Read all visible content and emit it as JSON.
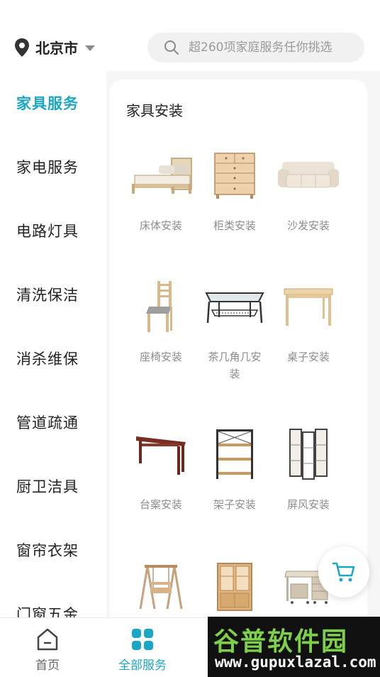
{
  "header": {
    "city": "北京市",
    "search_placeholder": "超260项家庭服务任你挑选"
  },
  "sidebar": {
    "items": [
      {
        "label": "家具服务",
        "active": true
      },
      {
        "label": "家电服务"
      },
      {
        "label": "电路灯具"
      },
      {
        "label": "清洗保洁"
      },
      {
        "label": "消杀维保"
      },
      {
        "label": "管道疏通"
      },
      {
        "label": "厨卫洁具"
      },
      {
        "label": "窗帘衣架"
      },
      {
        "label": "门窗五金"
      }
    ]
  },
  "section": {
    "title": "家具安装",
    "items": [
      {
        "label": "床体安装",
        "icon": "bed-icon"
      },
      {
        "label": "柜类安装",
        "icon": "cabinet-icon"
      },
      {
        "label": "沙发安装",
        "icon": "sofa-icon"
      },
      {
        "label": "座椅安装",
        "icon": "chair-icon"
      },
      {
        "label": "茶几角几安装",
        "icon": "coffee-table-icon"
      },
      {
        "label": "桌子安装",
        "icon": "desk-icon"
      },
      {
        "label": "台案安装",
        "icon": "console-table-icon"
      },
      {
        "label": "架子安装",
        "icon": "shelf-icon"
      },
      {
        "label": "屏风安装",
        "icon": "screen-icon"
      },
      {
        "label": "",
        "icon": "swing-icon"
      },
      {
        "label": "",
        "icon": "bookcase-icon"
      },
      {
        "label": "",
        "icon": "office-desk-icon"
      }
    ]
  },
  "bottom_nav": {
    "home": "首页",
    "all_services": "全部服务"
  },
  "watermark": {
    "title": "谷普软件园",
    "url": "www.gupuxlazal.com"
  },
  "colors": {
    "accent": "#1aa7c4",
    "text": "#222222",
    "muted": "#8c8c8c",
    "watermark_green": "#7ed04a"
  }
}
